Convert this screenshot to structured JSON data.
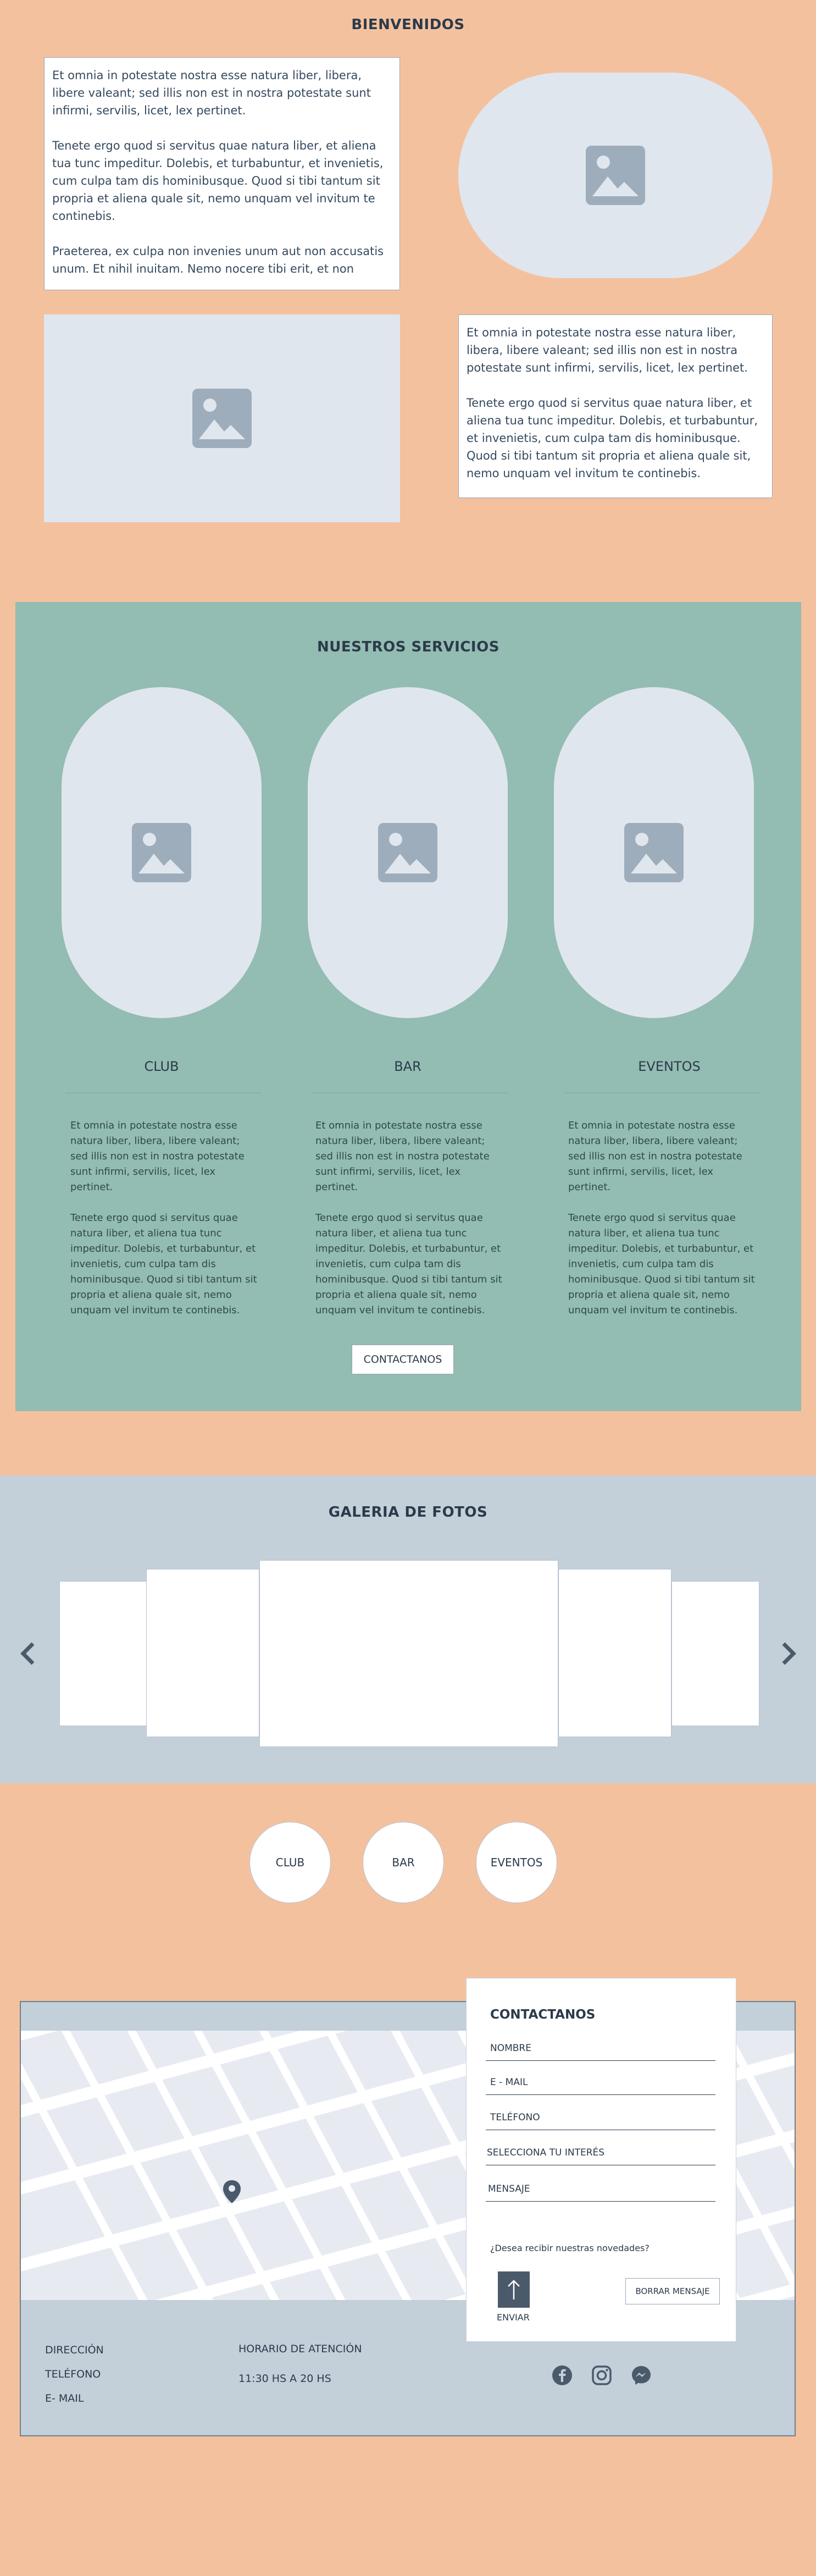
{
  "welcome": {
    "title": "BIENVENIDOS",
    "box1": {
      "p1": "Et omnia in potestate nostra esse natura liber, libera, libere valeant; sed illis non est in nostra potestate sunt infirmi, servilis, licet, lex pertinet.",
      "p2": "Tenete ergo quod si servitus quae natura liber, et aliena tua tunc impeditur. Dolebis, et turbabuntur, et invenietis, cum culpa tam dis hominibusque. Quod si tibi tantum sit propria et aliena quale sit, nemo unquam vel invitum te continebis.",
      "p3": "Praeterea, ex culpa non invenies unum aut non accusatis unum. Et nihil inuitam. Nemo nocere tibi erit, et non"
    },
    "box2": {
      "p1": "Et omnia in potestate nostra esse natura liber, libera, libere valeant; sed illis non est in nostra potestate sunt infirmi, servilis, licet, lex pertinet.",
      "p2": "Tenete ergo quod si servitus quae natura liber, et aliena tua tunc impeditur. Dolebis, et turbabuntur, et invenietis, cum culpa tam dis hominibusque. Quod si tibi tantum sit propria et aliena quale sit, nemo unquam vel invitum te continebis."
    }
  },
  "services": {
    "title": "NUESTROS SERVICIOS",
    "items": [
      {
        "label": "CLUB",
        "p1": "Et omnia in potestate nostra esse natura liber, libera, libere valeant; sed illis non est in nostra potestate sunt infirmi, servilis, licet, lex pertinet.",
        "p2": "Tenete ergo quod si servitus quae natura liber, et aliena tua tunc impeditur. Dolebis, et turbabuntur, et invenietis, cum culpa tam dis hominibusque. Quod si tibi tantum sit propria et aliena quale sit, nemo unquam vel invitum te continebis."
      },
      {
        "label": "BAR",
        "p1": "Et omnia in potestate nostra esse natura liber, libera, libere valeant; sed illis non est in nostra potestate sunt infirmi, servilis, licet, lex pertinet.",
        "p2": "Tenete ergo quod si servitus quae natura liber, et aliena tua tunc impeditur. Dolebis, et turbabuntur, et invenietis, cum culpa tam dis hominibusque. Quod si tibi tantum sit propria et aliena quale sit, nemo unquam vel invitum te continebis."
      },
      {
        "label": "EVENTOS",
        "p1": "Et omnia in potestate nostra esse natura liber, libera, libere valeant; sed illis non est in nostra potestate sunt infirmi, servilis, licet, lex pertinet.",
        "p2": "Tenete ergo quod si servitus quae natura liber, et aliena tua tunc impeditur. Dolebis, et turbabuntur, et invenietis, cum culpa tam dis hominibusque. Quod si tibi tantum sit propria et aliena quale sit, nemo unquam vel invitum te continebis."
      }
    ],
    "contact_button": "CONTACTANOS"
  },
  "gallery": {
    "title": "GALERIA DE FOTOS"
  },
  "quick_links": [
    "CLUB",
    "BAR",
    "EVENTOS"
  ],
  "contact_form": {
    "title": "CONTACTANOS",
    "fields": [
      "NOMBRE",
      "E - MAIL",
      "TELÉFONO",
      "SELECCIONA TU INTERÉS",
      "MENSAJE"
    ],
    "newsletter": "¿Desea recibir nuestras novedades?",
    "send_label": "ENVIAR",
    "clear_button": "BORRAR MENSAJE"
  },
  "footer": {
    "address": "DIRECCIÓN",
    "phone": "TELÉFONO",
    "email": "E- MAIL",
    "hours_title": "HORARIO DE ATENCIÓN",
    "hours": "11:30 HS A 20 HS",
    "social_icons": [
      "facebook-icon",
      "instagram-icon",
      "messenger-icon"
    ]
  },
  "colors": {
    "background": "#f4c19f",
    "services_bg": "#93bcb2",
    "gallery_bg": "#c3cfd9",
    "placeholder": "#e0e6ee",
    "text": "#2b3a4a"
  }
}
